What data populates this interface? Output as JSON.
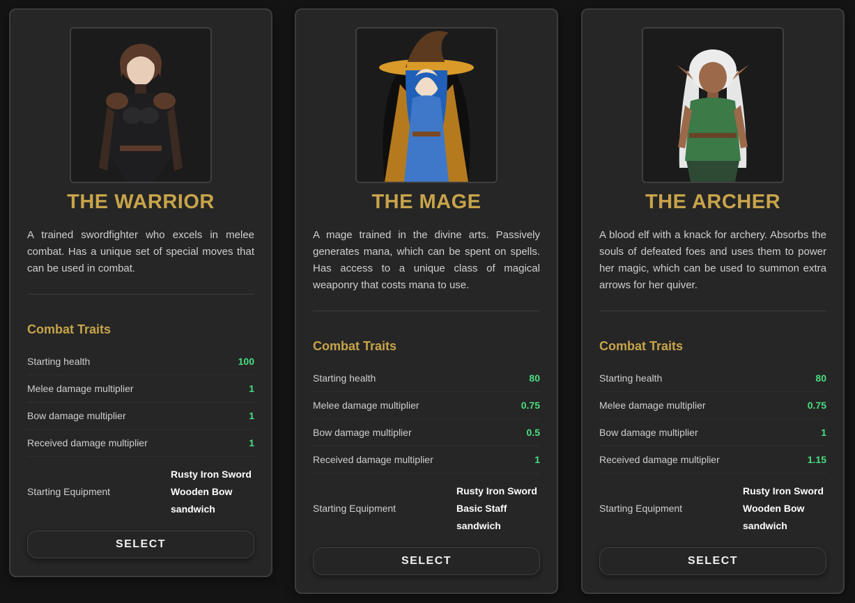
{
  "classes": [
    {
      "title": "THE WARRIOR",
      "description": "A trained swordfighter who excels in melee combat. Has a unique set of special moves that can be used in combat.",
      "traits_heading": "Combat Traits",
      "traits": [
        {
          "label": "Starting health",
          "value": "100"
        },
        {
          "label": "Melee damage multiplier",
          "value": "1"
        },
        {
          "label": "Bow damage multiplier",
          "value": "1"
        },
        {
          "label": "Received damage multiplier",
          "value": "1"
        }
      ],
      "equipment_label": "Starting Equipment",
      "equipment": [
        "Rusty Iron Sword",
        "Wooden Bow",
        "sandwich"
      ],
      "select_label": "SELECT"
    },
    {
      "title": "THE MAGE",
      "description": "A mage trained in the divine arts. Passively generates mana, which can be spent on spells. Has access to a unique class of magical weaponry that costs mana to use.",
      "traits_heading": "Combat Traits",
      "traits": [
        {
          "label": "Starting health",
          "value": "80"
        },
        {
          "label": "Melee damage multiplier",
          "value": "0.75"
        },
        {
          "label": "Bow damage multiplier",
          "value": "0.5"
        },
        {
          "label": "Received damage multiplier",
          "value": "1"
        }
      ],
      "equipment_label": "Starting Equipment",
      "equipment": [
        "Rusty Iron Sword",
        "Basic Staff",
        "sandwich"
      ],
      "select_label": "SELECT"
    },
    {
      "title": "THE ARCHER",
      "description": "A blood elf with a knack for archery. Absorbs the souls of defeated foes and uses them to power her magic, which can be used to summon extra arrows for her quiver.",
      "traits_heading": "Combat Traits",
      "traits": [
        {
          "label": "Starting health",
          "value": "80"
        },
        {
          "label": "Melee damage multiplier",
          "value": "0.75"
        },
        {
          "label": "Bow damage multiplier",
          "value": "1"
        },
        {
          "label": "Received damage multiplier",
          "value": "1.15"
        }
      ],
      "equipment_label": "Starting Equipment",
      "equipment": [
        "Rusty Iron Sword",
        "Wooden Bow",
        "sandwich"
      ],
      "select_label": "SELECT"
    }
  ],
  "colors": {
    "accent_gold": "#c8a44a",
    "trait_value_green": "#4ade80",
    "card_bg": "#262626",
    "page_bg": "#141414"
  },
  "icons": [
    "warrior-portrait-image",
    "mage-portrait-image",
    "archer-portrait-image"
  ]
}
